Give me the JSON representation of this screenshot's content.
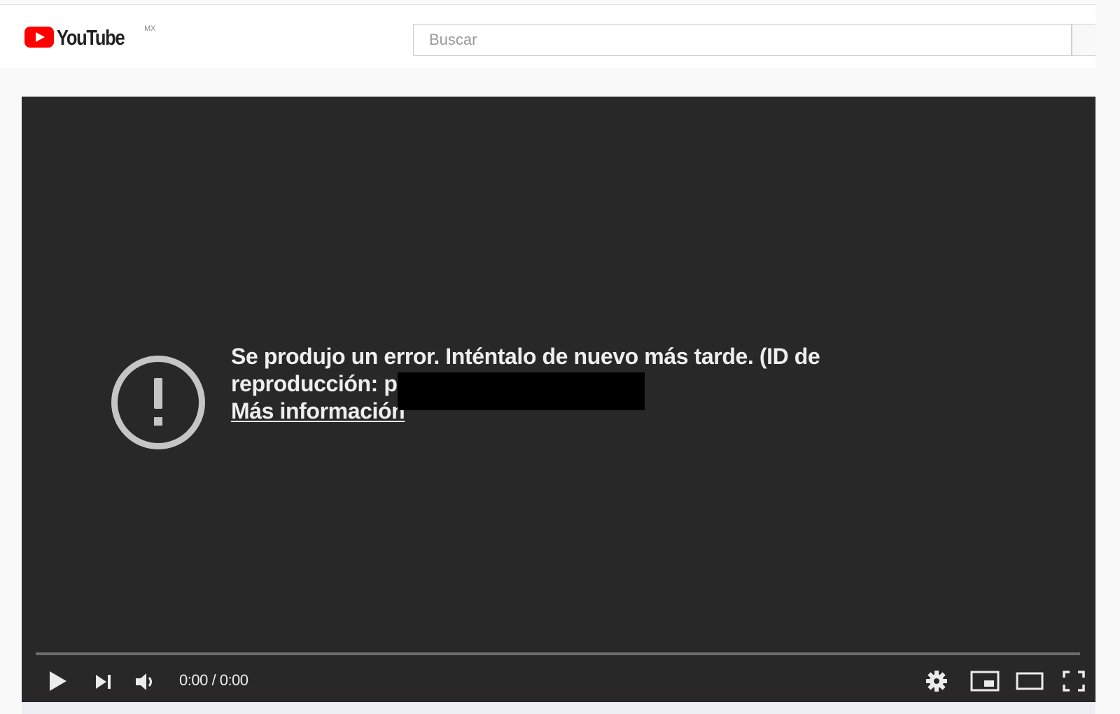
{
  "masthead": {
    "logo_text": "YouTube",
    "country_code": "MX",
    "search_placeholder": "Buscar"
  },
  "player": {
    "error_message_line1": "Se produjo un error. Inténtalo de nuevo más tarde. (ID de",
    "error_message_line2": "reproducción: p",
    "learn_more_label": "Más información",
    "time_current": "0:00",
    "time_separator": "/",
    "time_total": "0:00",
    "progress": 0
  },
  "icons": {
    "logo": "youtube-logo-icon",
    "error": "exclamation-circle-icon",
    "play": "play-icon",
    "next": "skip-next-icon",
    "volume": "volume-icon",
    "settings": "gear-icon",
    "miniplayer": "miniplayer-icon",
    "theater": "theater-mode-icon",
    "fullscreen": "fullscreen-icon"
  },
  "colors": {
    "brand_red": "#ff0000",
    "player_background": "#282828",
    "error_text": "#eeeeee"
  }
}
